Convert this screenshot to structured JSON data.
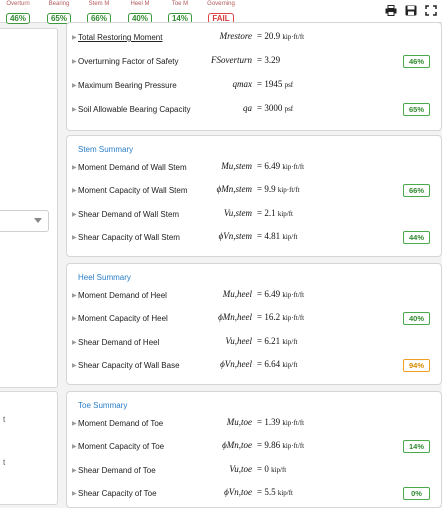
{
  "status_bar": [
    {
      "label": "Overturn",
      "value": "46%",
      "state": "pass"
    },
    {
      "label": "Bearing",
      "value": "65%",
      "state": "pass"
    },
    {
      "label": "Stem M",
      "value": "66%",
      "state": "pass"
    },
    {
      "label": "Heel M",
      "value": "40%",
      "state": "pass"
    },
    {
      "label": "Toe M",
      "value": "14%",
      "state": "pass"
    },
    {
      "label": "Governing",
      "value": "FAIL",
      "state": "fail"
    }
  ],
  "toolbar": {
    "icons": [
      "print-icon",
      "save-icon",
      "expand-icon"
    ]
  },
  "colors": {
    "pass": "#3c9a3c",
    "fail": "#e04545",
    "warn": "#f0a020",
    "heading": "#2a7ec6"
  },
  "left_panel": {
    "tick_labels": [
      "t",
      "t"
    ]
  },
  "overturning": {
    "rows": [
      {
        "label": "Total Restoring Moment",
        "symbol": "Mrestore",
        "value": "= 20.9",
        "unit": "kip·ft/ft",
        "badge": ""
      },
      {
        "label": "Overturning Factor of Safety",
        "symbol": "FSoverturn",
        "value": "= 3.29",
        "unit": "",
        "badge": "46%"
      },
      {
        "label": "Maximum Bearing Pressure",
        "symbol": "qmax",
        "value": "= 1945",
        "unit": "psf",
        "badge": ""
      },
      {
        "label": "Soil Allowable Bearing Capacity",
        "symbol": "qa",
        "value": "= 3000",
        "unit": "psf",
        "badge": "65%"
      }
    ]
  },
  "stem": {
    "title": "Stem Summary",
    "rows": [
      {
        "label": "Moment Demand of Wall Stem",
        "symbol": "Mu,stem",
        "value": "= 6.49",
        "unit": "kip·ft/ft",
        "badge": ""
      },
      {
        "label": "Moment Capacity of Wall Stem",
        "symbol": "ϕMn,stem",
        "value": "= 9.9",
        "unit": "kip·ft/ft",
        "badge": "66%"
      },
      {
        "label": "Shear Demand of Wall Stem",
        "symbol": "Vu,stem",
        "value": "= 2.1",
        "unit": "kip/ft",
        "badge": ""
      },
      {
        "label": "Shear Capacity of Wall Stem",
        "symbol": "ϕVn,stem",
        "value": "= 4.81",
        "unit": "kip/ft",
        "badge": "44%"
      }
    ]
  },
  "heel": {
    "title": "Heel Summary",
    "rows": [
      {
        "label": "Moment Demand of Heel",
        "symbol": "Mu,heel",
        "value": "= 6.49",
        "unit": "kip·ft/ft",
        "badge": ""
      },
      {
        "label": "Moment Capacity of Heel",
        "symbol": "ϕMn,heel",
        "value": "= 16.2",
        "unit": "kip·ft/ft",
        "badge": "40%"
      },
      {
        "label": "Shear Demand of Heel",
        "symbol": "Vu,heel",
        "value": "= 6.21",
        "unit": "kip/ft",
        "badge": ""
      },
      {
        "label": "Shear Capacity of Wall Base",
        "symbol": "ϕVn,heel",
        "value": "= 6.64",
        "unit": "kip/ft",
        "badge": "94%",
        "badge_state": "warn"
      }
    ]
  },
  "toe": {
    "title": "Toe Summary",
    "rows": [
      {
        "label": "Moment Demand of Toe",
        "symbol": "Mu,toe",
        "value": "= 1.39",
        "unit": "kip·ft/ft",
        "badge": ""
      },
      {
        "label": "Moment Capacity of Toe",
        "symbol": "ϕMn,toe",
        "value": "= 9.86",
        "unit": "kip·ft/ft",
        "badge": "14%"
      },
      {
        "label": "Shear Demand of Toe",
        "symbol": "Vu,toe",
        "value": "= 0",
        "unit": "kip/ft",
        "badge": ""
      },
      {
        "label": "Shear Capacity of Toe",
        "symbol": "ϕVn,toe",
        "value": "= 5.5",
        "unit": "kip/ft",
        "badge": "0%"
      }
    ]
  }
}
